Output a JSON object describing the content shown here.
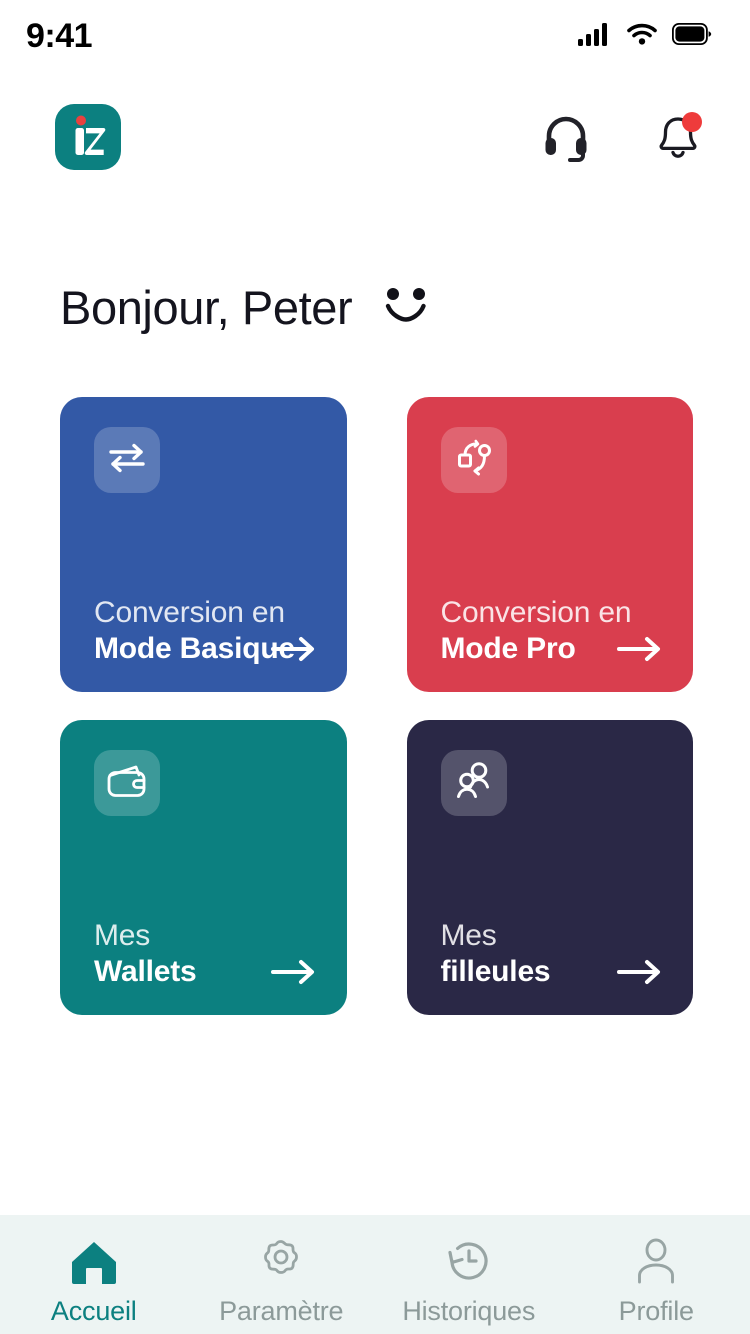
{
  "status_bar": {
    "time": "9:41",
    "icons": [
      "cellular-signal-icon",
      "wifi-icon",
      "battery-icon"
    ]
  },
  "header": {
    "logo_name": "izichange-logo",
    "logo_letter": "iz",
    "logo_color": "#0C8080",
    "actions": [
      {
        "name": "support-headset-icon",
        "label": "Support"
      },
      {
        "name": "notifications-bell-icon",
        "label": "Notifications",
        "badge": true,
        "badge_color": "#EE3B3B"
      }
    ]
  },
  "greeting": {
    "text": "Bonjour, Peter",
    "emoji_name": "smiley-face-icon"
  },
  "cards": [
    {
      "name": "conversion-mode-basique",
      "line1": "Conversion en",
      "line2": "Mode Basique",
      "icon": "exchange-arrows-icon",
      "bg": "#3359A6",
      "badge_bg": "rgba(255,255,255,0.18)"
    },
    {
      "name": "conversion-mode-pro",
      "line1": "Conversion en",
      "line2": "Mode Pro",
      "icon": "vector-path-icon",
      "bg": "#D93E4E",
      "badge_bg": "rgba(255,255,255,0.20)"
    },
    {
      "name": "mes-wallets",
      "line1": "Mes",
      "line2": "Wallets",
      "icon": "wallet-icon",
      "bg": "#0C8080",
      "badge_bg": "rgba(255,255,255,0.18)"
    },
    {
      "name": "mes-filleules",
      "line1": "Mes",
      "line2": "filleules",
      "icon": "two-people-icon",
      "bg": "#2A2846",
      "badge_bg": "rgba(255,255,255,0.14)"
    }
  ],
  "tabbar": {
    "active_color": "#0C8080",
    "inactive_color": "#8C9A99",
    "background": "#EDF4F3",
    "items": [
      {
        "name": "tab-accueil",
        "label": "Accueil",
        "icon": "home-icon",
        "active": true
      },
      {
        "name": "tab-parametre",
        "label": "Paramètre",
        "icon": "gear-icon",
        "active": false
      },
      {
        "name": "tab-historiques",
        "label": "Historiques",
        "icon": "history-icon",
        "active": false
      },
      {
        "name": "tab-profile",
        "label": "Profile",
        "icon": "person-icon",
        "active": false
      }
    ]
  }
}
